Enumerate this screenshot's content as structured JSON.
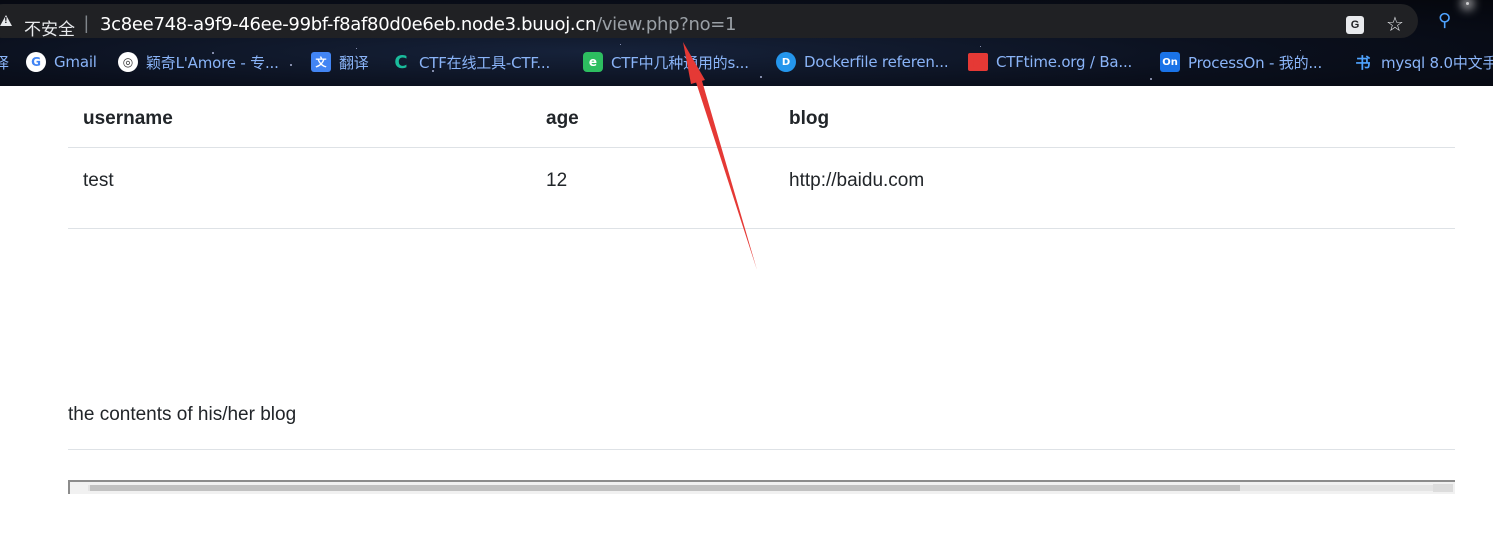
{
  "browser": {
    "security_label": "不安全",
    "url_host": "3c8ee748-a9f9-46ee-99bf-f8af80d0e6eb.node3.buuoj.cn",
    "url_path": "/view.php?no=1",
    "bookmarks": [
      {
        "label": "Gmail",
        "icon": "google-icon",
        "glyph": "G"
      },
      {
        "label": "颖奇L'Amore - 专...",
        "icon": "globe-icon",
        "glyph": "◎"
      },
      {
        "label": "翻译",
        "icon": "google-translate-icon",
        "glyph": "文"
      },
      {
        "label": "CTF在线工具-CTF...",
        "icon": "ctf-tools-icon",
        "glyph": "C"
      },
      {
        "label": "CTF中几种通用的s...",
        "icon": "evernote-icon",
        "glyph": "e"
      },
      {
        "label": "Dockerfile referen...",
        "icon": "docker-icon",
        "glyph": "D"
      },
      {
        "label": "CTFtime.org / Ba...",
        "icon": "ctftime-flag-icon",
        "glyph": "▶"
      },
      {
        "label": "ProcessOn - 我的...",
        "icon": "processon-icon",
        "glyph": "On"
      },
      {
        "label": "mysql 8.0中文手",
        "icon": "book-icon",
        "glyph": "书"
      }
    ]
  },
  "table": {
    "headers": [
      "username",
      "age",
      "blog"
    ],
    "rows": [
      [
        "test",
        "12",
        "http://baidu.com"
      ]
    ]
  },
  "blog_section": {
    "text": "the contents of his/her blog"
  },
  "colors": {
    "chrome_bg": "#0a0f1c",
    "omnibox_bg": "#202124",
    "bookmark_text": "#8ab4f8",
    "annotation_arrow": "#e53935"
  }
}
